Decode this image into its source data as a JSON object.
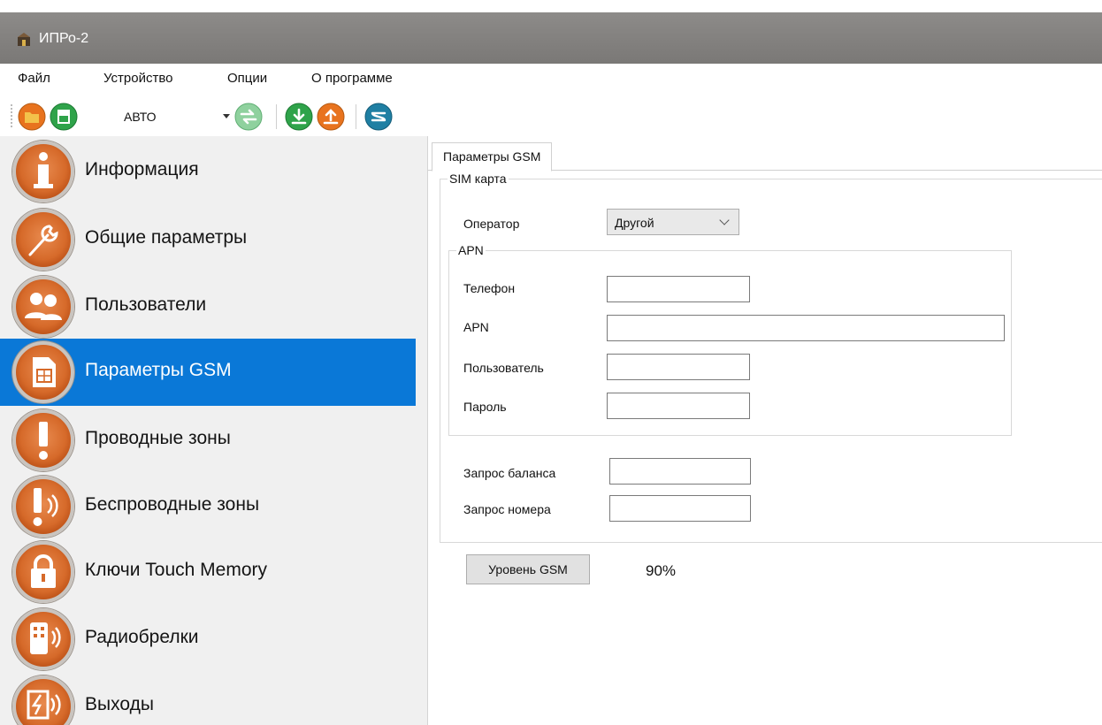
{
  "window": {
    "title": "ИПРо-2"
  },
  "menu": [
    "Файл",
    "Устройство",
    "Опции",
    "О программе"
  ],
  "toolbar": {
    "mode_value": "АВТО",
    "buttons": [
      "folder-open-icon",
      "save-icon",
      "swap-icon",
      "download-icon",
      "upload-icon",
      "connect-icon"
    ],
    "colors": {
      "orange": "#e8731e",
      "green": "#2fa34a",
      "teal": "#1f7fa3"
    }
  },
  "sidebar": {
    "active_color": "#0a78d7",
    "items": [
      {
        "label": "Информация",
        "icon": "info-icon"
      },
      {
        "label": "Общие параметры",
        "icon": "wrench-icon"
      },
      {
        "label": "Пользователи",
        "icon": "users-icon"
      },
      {
        "label": "Параметры GSM",
        "icon": "sim-card-icon",
        "active": true
      },
      {
        "label": "Проводные зоны",
        "icon": "exclamation-icon"
      },
      {
        "label": "Беспроводные зоны",
        "icon": "wireless-zone-icon"
      },
      {
        "label": "Ключи Touch Memory",
        "icon": "lock-icon"
      },
      {
        "label": "Радиобрелки",
        "icon": "key-fob-icon"
      },
      {
        "label": "Выходы",
        "icon": "output-icon"
      }
    ]
  },
  "tab": {
    "label": "Параметры GSM"
  },
  "sim": {
    "legend": "SIM карта",
    "operator_label": "Оператор",
    "operator_value": "Другой",
    "apn_group": {
      "legend": "APN",
      "phone_label": "Телефон",
      "phone_value": "",
      "apn_label": "APN",
      "apn_value": "",
      "user_label": "Пользователь",
      "user_value": "",
      "password_label": "Пароль",
      "password_value": ""
    },
    "balance_label": "Запрос баланса",
    "balance_value": "",
    "number_label": "Запрос номера",
    "number_value": ""
  },
  "gsm": {
    "button_label": "Уровень GSM",
    "level": "90%"
  }
}
